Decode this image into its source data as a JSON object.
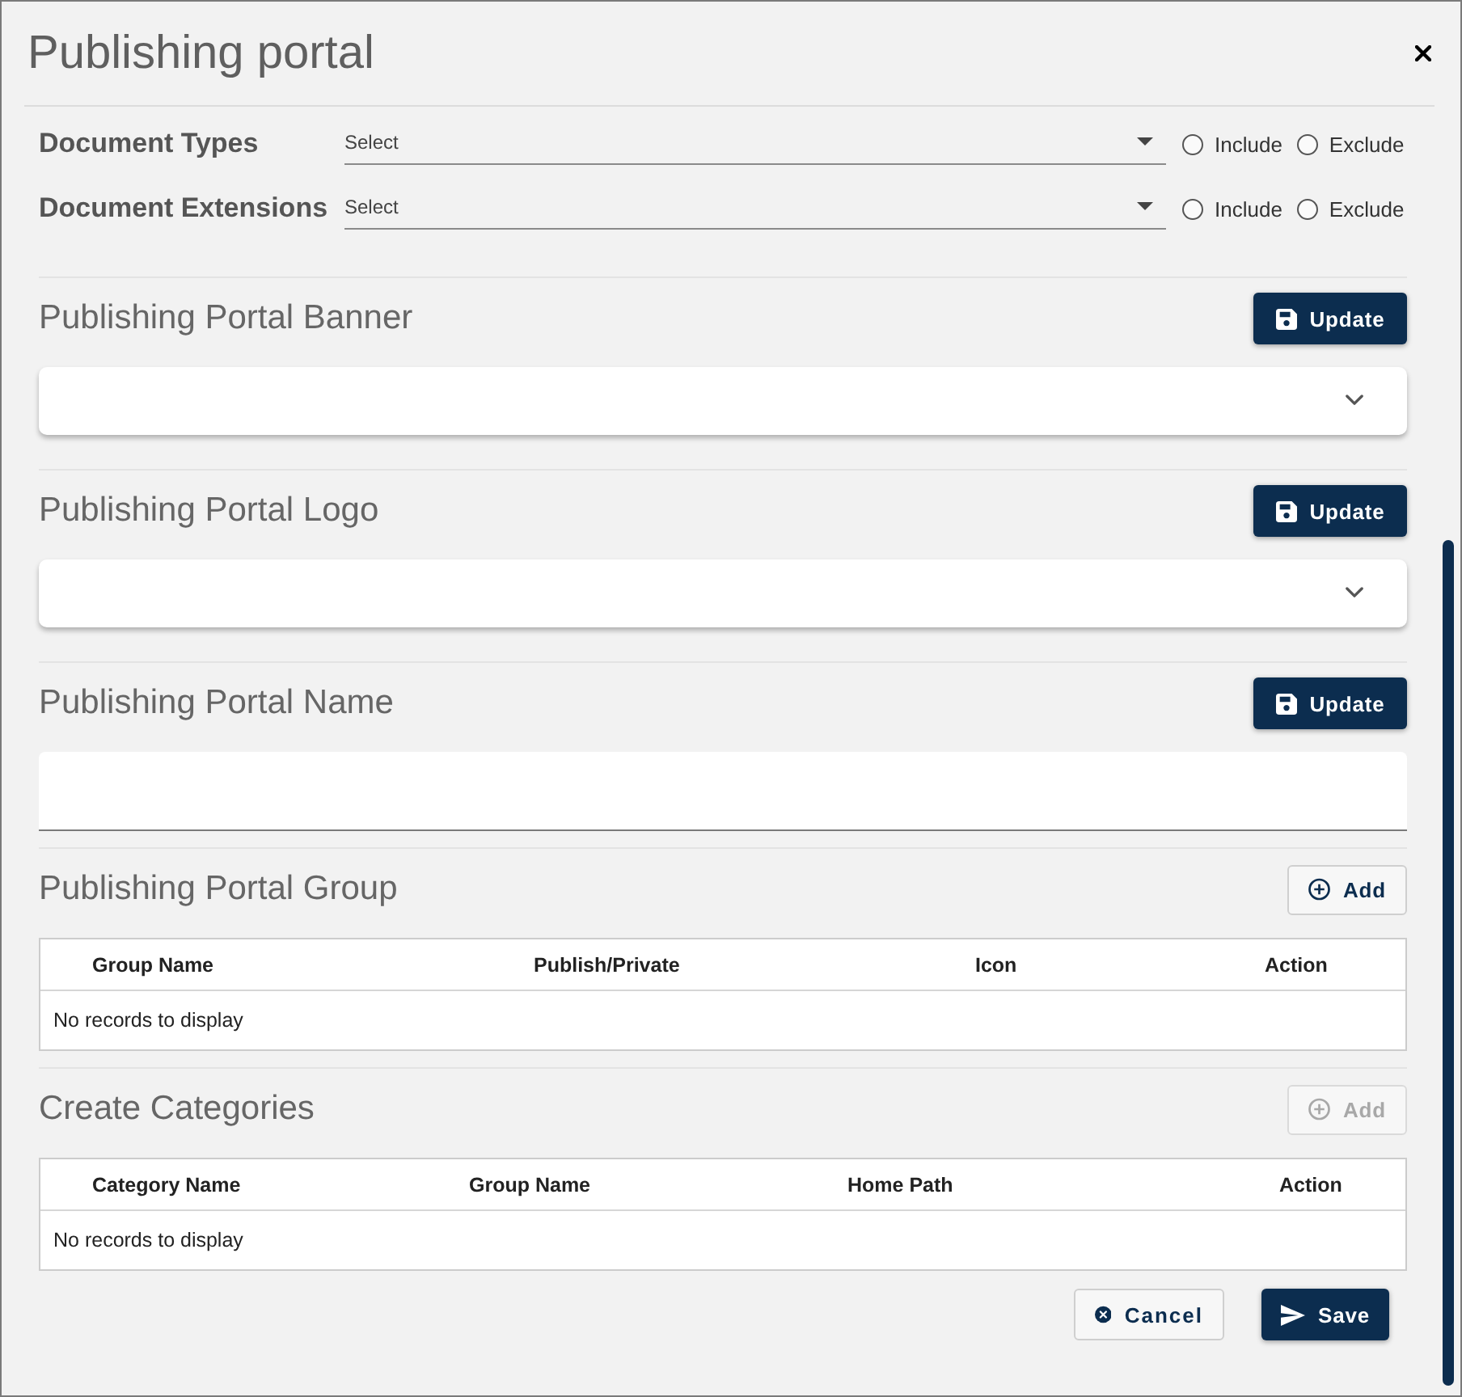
{
  "dialog": {
    "title": "Publishing portal"
  },
  "filters": [
    {
      "label": "Document Types",
      "placeholder": "Select",
      "options": [
        {
          "label": "Include",
          "selected": false
        },
        {
          "label": "Exclude",
          "selected": false
        }
      ]
    },
    {
      "label": "Document Extensions",
      "placeholder": "Select",
      "options": [
        {
          "label": "Include",
          "selected": false
        },
        {
          "label": "Exclude",
          "selected": false
        }
      ]
    }
  ],
  "sections": [
    {
      "kind": "panel",
      "title": "Publishing Portal Banner",
      "expanded": false,
      "action": {
        "kind": "update",
        "label": "Update",
        "disabled": false
      }
    },
    {
      "kind": "panel",
      "title": "Publishing Portal Logo",
      "expanded": false,
      "action": {
        "kind": "update",
        "label": "Update",
        "disabled": false
      }
    },
    {
      "kind": "field",
      "title": "Publishing Portal Name",
      "action": {
        "kind": "update",
        "label": "Update",
        "disabled": false
      }
    },
    {
      "kind": "table",
      "title": "Publishing Portal Group",
      "action": {
        "kind": "add",
        "label": "Add",
        "disabled": false
      },
      "columns": [
        "Group Name",
        "Publish/Private",
        "Icon",
        "Action"
      ],
      "empty_text": "No records to display"
    },
    {
      "kind": "table",
      "title": "Create Categories",
      "action": {
        "kind": "add",
        "label": "Add",
        "disabled": true
      },
      "columns": [
        "Category Name",
        "Group Name",
        "Home Path",
        "Action"
      ],
      "empty_text": "No records to display"
    }
  ],
  "footer": {
    "buttons": [
      {
        "kind": "cancel",
        "label": "Cancel",
        "disabled": false
      },
      {
        "kind": "save",
        "label": "Save",
        "disabled": false
      }
    ]
  }
}
